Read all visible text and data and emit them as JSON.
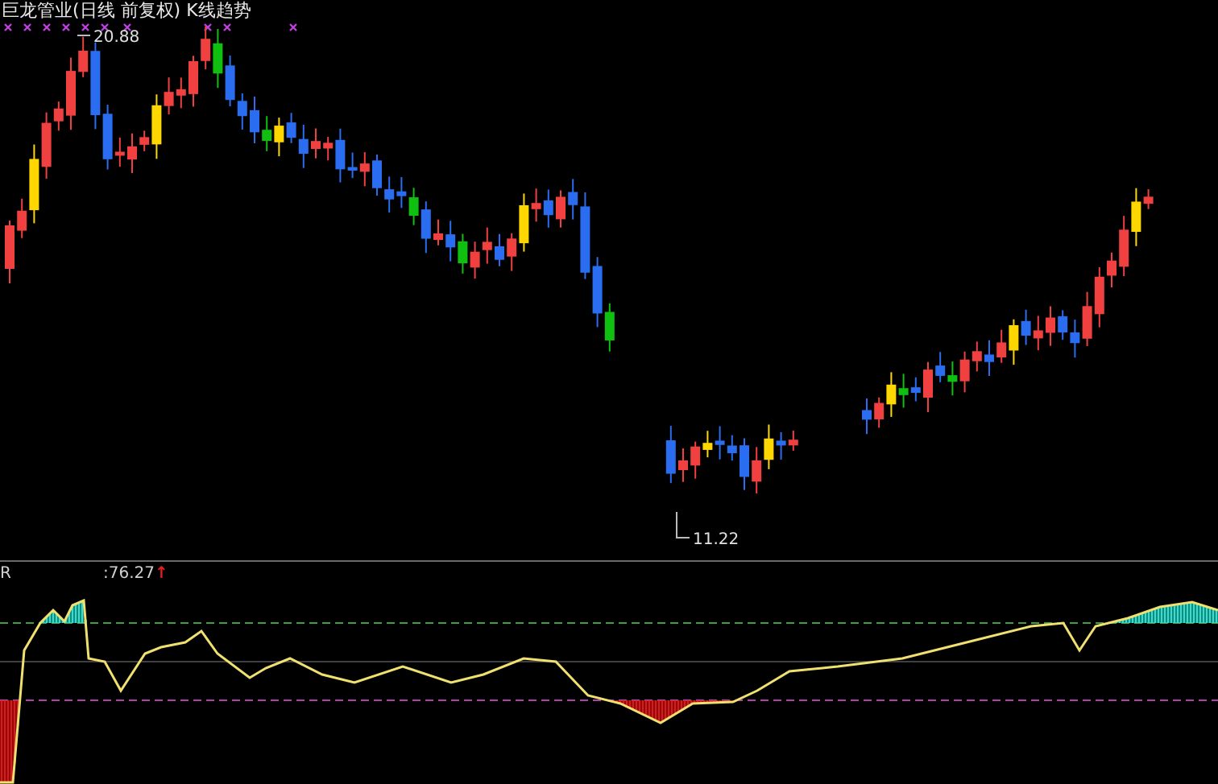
{
  "chart": {
    "title": "巨龙管业(日线 前复权) K线趋势",
    "high_label": "20.88",
    "low_label": "11.22"
  },
  "indicator": {
    "name": "R",
    "value": ":76.27",
    "arrow": "↑"
  }
}
